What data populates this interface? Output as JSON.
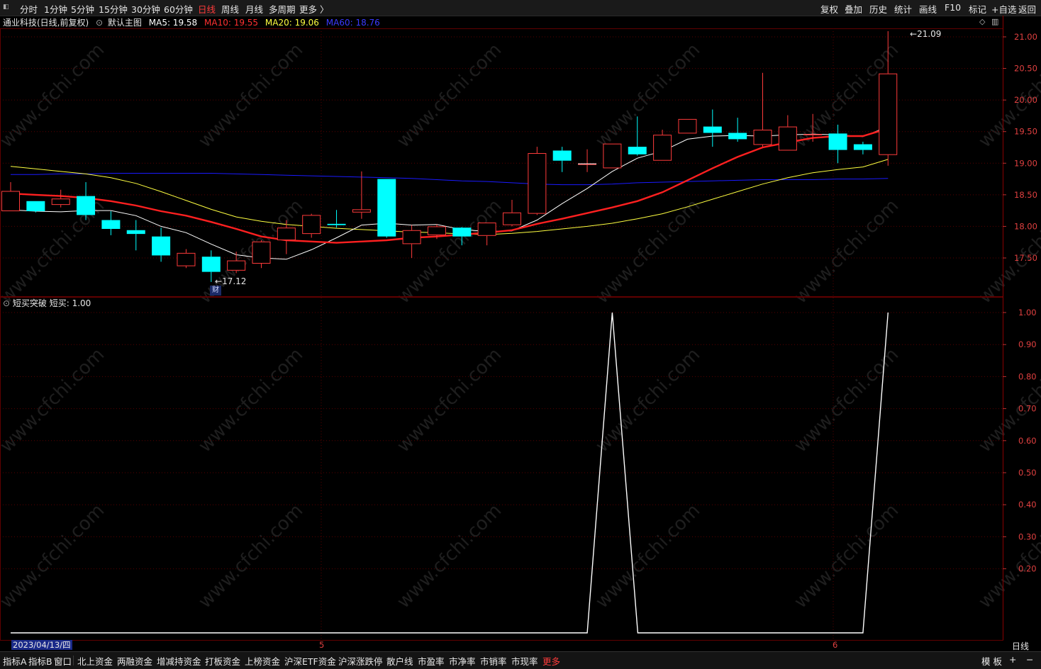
{
  "topbar": {
    "periods": [
      "分时",
      "1分钟",
      "5分钟",
      "15分钟",
      "30分钟",
      "60分钟",
      "日线",
      "周线",
      "月线",
      "多周期",
      "更多 〉"
    ],
    "active_period": "日线",
    "right_tools": [
      "复权",
      "叠加",
      "历史",
      "统计",
      "画线",
      "F10",
      "标记",
      "+自选",
      "返回"
    ]
  },
  "main_legend": {
    "stock": "通业科技(日线,前复权)",
    "template": "默认主图",
    "ma5": "MA5: 19.58",
    "ma10": "MA10: 19.55",
    "ma20": "MA20: 19.06",
    "ma60": "MA60: 18.76"
  },
  "indicator_legend": {
    "name": "短买突破",
    "value": "短买: 1.00"
  },
  "annotations": {
    "high": "21.09",
    "low": "17.12",
    "cai_badge": "财"
  },
  "date_axis": {
    "start": "2023/04/13/四",
    "month_marks": [
      "5",
      "6"
    ],
    "period_label": "日线"
  },
  "colors": {
    "up": "#ff3b3b",
    "down": "#00ffff",
    "ma5": "#ffffff",
    "ma10": "#ff2020",
    "ma20": "#ffff40",
    "ma60": "#1a1aff",
    "grid": "#5a0000"
  },
  "watermark_text": "www.cfchi.com",
  "bottombar": {
    "tabs": [
      "指标A",
      "指标B",
      "窗口",
      "北上资金",
      "两融资金",
      "增减持资金",
      "打板资金",
      "上榜资金",
      "沪深ETF资金",
      "沪深涨跌停",
      "散户线",
      "市盈率",
      "市净率",
      "市销率",
      "市现率",
      "更多"
    ],
    "right": [
      "模 板",
      "+",
      "−"
    ]
  },
  "chart_data": [
    {
      "type": "candlestick",
      "title": "通业科技(日线,前复权)",
      "y_ticks": [
        "21.00",
        "20.50",
        "20.00",
        "19.50",
        "19.00",
        "18.50",
        "18.00",
        "17.50"
      ],
      "ylim": [
        17.0,
        21.4
      ],
      "candles": [
        {
          "o": 18.24,
          "c": 18.56,
          "h": 18.7,
          "l": 18.24
        },
        {
          "o": 18.4,
          "c": 18.24,
          "h": 18.4,
          "l": 18.22
        },
        {
          "o": 18.34,
          "c": 18.44,
          "h": 18.58,
          "l": 18.3
        },
        {
          "o": 18.48,
          "c": 18.18,
          "h": 18.7,
          "l": 18.1
        },
        {
          "o": 18.1,
          "c": 17.96,
          "h": 18.24,
          "l": 17.86
        },
        {
          "o": 17.94,
          "c": 17.88,
          "h": 18.1,
          "l": 17.62
        },
        {
          "o": 17.84,
          "c": 17.54,
          "h": 17.98,
          "l": 17.44
        },
        {
          "o": 17.37,
          "c": 17.58,
          "h": 17.64,
          "l": 17.34
        },
        {
          "o": 17.52,
          "c": 17.28,
          "h": 17.62,
          "l": 17.12
        },
        {
          "o": 17.3,
          "c": 17.46,
          "h": 17.6,
          "l": 17.26
        },
        {
          "o": 17.41,
          "c": 17.76,
          "h": 17.78,
          "l": 17.34
        },
        {
          "o": 17.78,
          "c": 17.98,
          "h": 18.1,
          "l": 17.56
        },
        {
          "o": 17.88,
          "c": 18.18,
          "h": 18.2,
          "l": 17.82
        },
        {
          "o": 18.04,
          "c": 18.02,
          "h": 18.26,
          "l": 17.98
        },
        {
          "o": 18.22,
          "c": 18.27,
          "h": 18.87,
          "l": 18.12
        },
        {
          "o": 18.75,
          "c": 17.84,
          "h": 18.75,
          "l": 17.82
        },
        {
          "o": 17.72,
          "c": 17.94,
          "h": 18.02,
          "l": 17.5
        },
        {
          "o": 17.86,
          "c": 18.0,
          "h": 18.03,
          "l": 17.8
        },
        {
          "o": 17.98,
          "c": 17.84,
          "h": 17.99,
          "l": 17.7
        },
        {
          "o": 17.85,
          "c": 18.06,
          "h": 18.06,
          "l": 17.7
        },
        {
          "o": 18.02,
          "c": 18.22,
          "h": 18.42,
          "l": 18.0
        },
        {
          "o": 18.2,
          "c": 19.16,
          "h": 19.26,
          "l": 18.18
        },
        {
          "o": 19.2,
          "c": 19.04,
          "h": 19.26,
          "l": 18.86
        },
        {
          "o": 18.99,
          "c": 18.99,
          "h": 19.22,
          "l": 18.86
        },
        {
          "o": 18.92,
          "c": 19.31,
          "h": 19.31,
          "l": 18.92
        },
        {
          "o": 19.26,
          "c": 19.14,
          "h": 19.74,
          "l": 19.12
        },
        {
          "o": 19.04,
          "c": 19.45,
          "h": 19.53,
          "l": 19.04
        },
        {
          "o": 19.47,
          "c": 19.7,
          "h": 19.7,
          "l": 19.47
        },
        {
          "o": 19.58,
          "c": 19.48,
          "h": 19.85,
          "l": 19.26
        },
        {
          "o": 19.48,
          "c": 19.38,
          "h": 19.72,
          "l": 19.34
        },
        {
          "o": 19.29,
          "c": 19.53,
          "h": 20.43,
          "l": 19.26
        },
        {
          "o": 19.2,
          "c": 19.58,
          "h": 19.76,
          "l": 19.2
        },
        {
          "o": 19.45,
          "c": 19.46,
          "h": 19.78,
          "l": 19.34
        },
        {
          "o": 19.47,
          "c": 19.21,
          "h": 19.61,
          "l": 19.0
        },
        {
          "o": 19.3,
          "c": 19.21,
          "h": 19.34,
          "l": 19.14
        },
        {
          "o": 19.13,
          "c": 20.42,
          "h": 21.09,
          "l": 18.96
        }
      ],
      "ma5": [
        18.26,
        18.24,
        18.23,
        18.25,
        18.25,
        18.17,
        18.0,
        17.9,
        17.72,
        17.55,
        17.5,
        17.48,
        17.63,
        17.82,
        18.02,
        18.05,
        18.02,
        18.03,
        17.95,
        17.92,
        17.93,
        18.1,
        18.36,
        18.6,
        18.87,
        19.08,
        19.19,
        19.38,
        19.43,
        19.44,
        19.43,
        19.45,
        19.46,
        19.45,
        19.42,
        19.58
      ],
      "ma10": [
        18.52,
        18.5,
        18.48,
        18.45,
        18.4,
        18.33,
        18.24,
        18.17,
        18.07,
        17.96,
        17.84,
        17.78,
        17.76,
        17.74,
        17.76,
        17.78,
        17.82,
        17.84,
        17.87,
        17.9,
        17.94,
        18.04,
        18.12,
        18.21,
        18.3,
        18.4,
        18.54,
        18.73,
        18.92,
        19.1,
        19.25,
        19.33,
        19.4,
        19.43,
        19.43,
        19.55
      ],
      "ma20": [
        18.95,
        18.91,
        18.87,
        18.83,
        18.77,
        18.68,
        18.55,
        18.41,
        18.27,
        18.15,
        18.08,
        18.03,
        18.0,
        17.97,
        17.95,
        17.93,
        17.91,
        17.9,
        17.88,
        17.87,
        17.89,
        17.92,
        17.96,
        18.0,
        18.05,
        18.12,
        18.2,
        18.31,
        18.43,
        18.55,
        18.67,
        18.77,
        18.85,
        18.9,
        18.94,
        19.06
      ],
      "ma60": [
        18.82,
        18.82,
        18.83,
        18.83,
        18.84,
        18.84,
        18.84,
        18.84,
        18.84,
        18.83,
        18.82,
        18.81,
        18.8,
        18.79,
        18.78,
        18.77,
        18.76,
        18.74,
        18.72,
        18.71,
        18.69,
        18.67,
        18.66,
        18.66,
        18.67,
        18.69,
        18.7,
        18.71,
        18.72,
        18.73,
        18.74,
        18.74,
        18.74,
        18.75,
        18.75,
        18.76
      ]
    },
    {
      "type": "line",
      "title": "短买突破",
      "series": [
        {
          "name": "短买",
          "values": [
            0,
            0,
            0,
            0,
            0,
            0,
            0,
            0,
            0,
            0,
            0,
            0,
            0,
            0,
            0,
            0,
            0,
            0,
            0,
            0,
            0,
            0,
            0,
            0,
            1,
            0,
            0,
            0,
            0,
            0,
            0,
            0,
            0,
            0,
            0,
            1
          ]
        }
      ],
      "y_ticks": [
        "1.00",
        "0.90",
        "0.80",
        "0.70",
        "0.60",
        "0.50",
        "0.40",
        "0.30",
        "0.20"
      ],
      "ylim": [
        0,
        1
      ]
    }
  ]
}
